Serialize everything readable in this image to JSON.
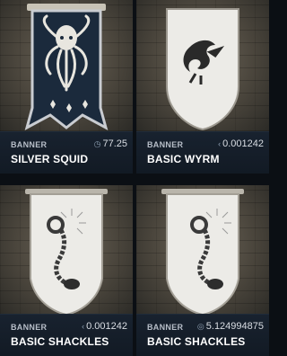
{
  "cards": [
    {
      "type_label": "BANNER",
      "price": "77.25",
      "currency_icon": "rupee-like-coin-icon",
      "name": "SILVER SQUID",
      "art": "squid-banner-icon",
      "banner_color": "#1d2f44"
    },
    {
      "type_label": "BANNER",
      "price": "0.001242",
      "currency_icon": "arc-coin-icon",
      "name": "BASIC WYRM",
      "art": "wyrm-banner-icon",
      "banner_color": "#e9e8e4"
    },
    {
      "type_label": "BANNER",
      "price": "0.001242",
      "currency_icon": "arc-coin-icon",
      "name": "BASIC SHACKLES",
      "art": "shackles-banner-icon",
      "banner_color": "#e9e8e4"
    },
    {
      "type_label": "BANNER",
      "price": "5.124994875",
      "currency_icon": "ring-coin-icon",
      "name": "BASIC SHACKLES",
      "art": "shackles-banner-icon",
      "banner_color": "#e9e8e4"
    }
  ]
}
